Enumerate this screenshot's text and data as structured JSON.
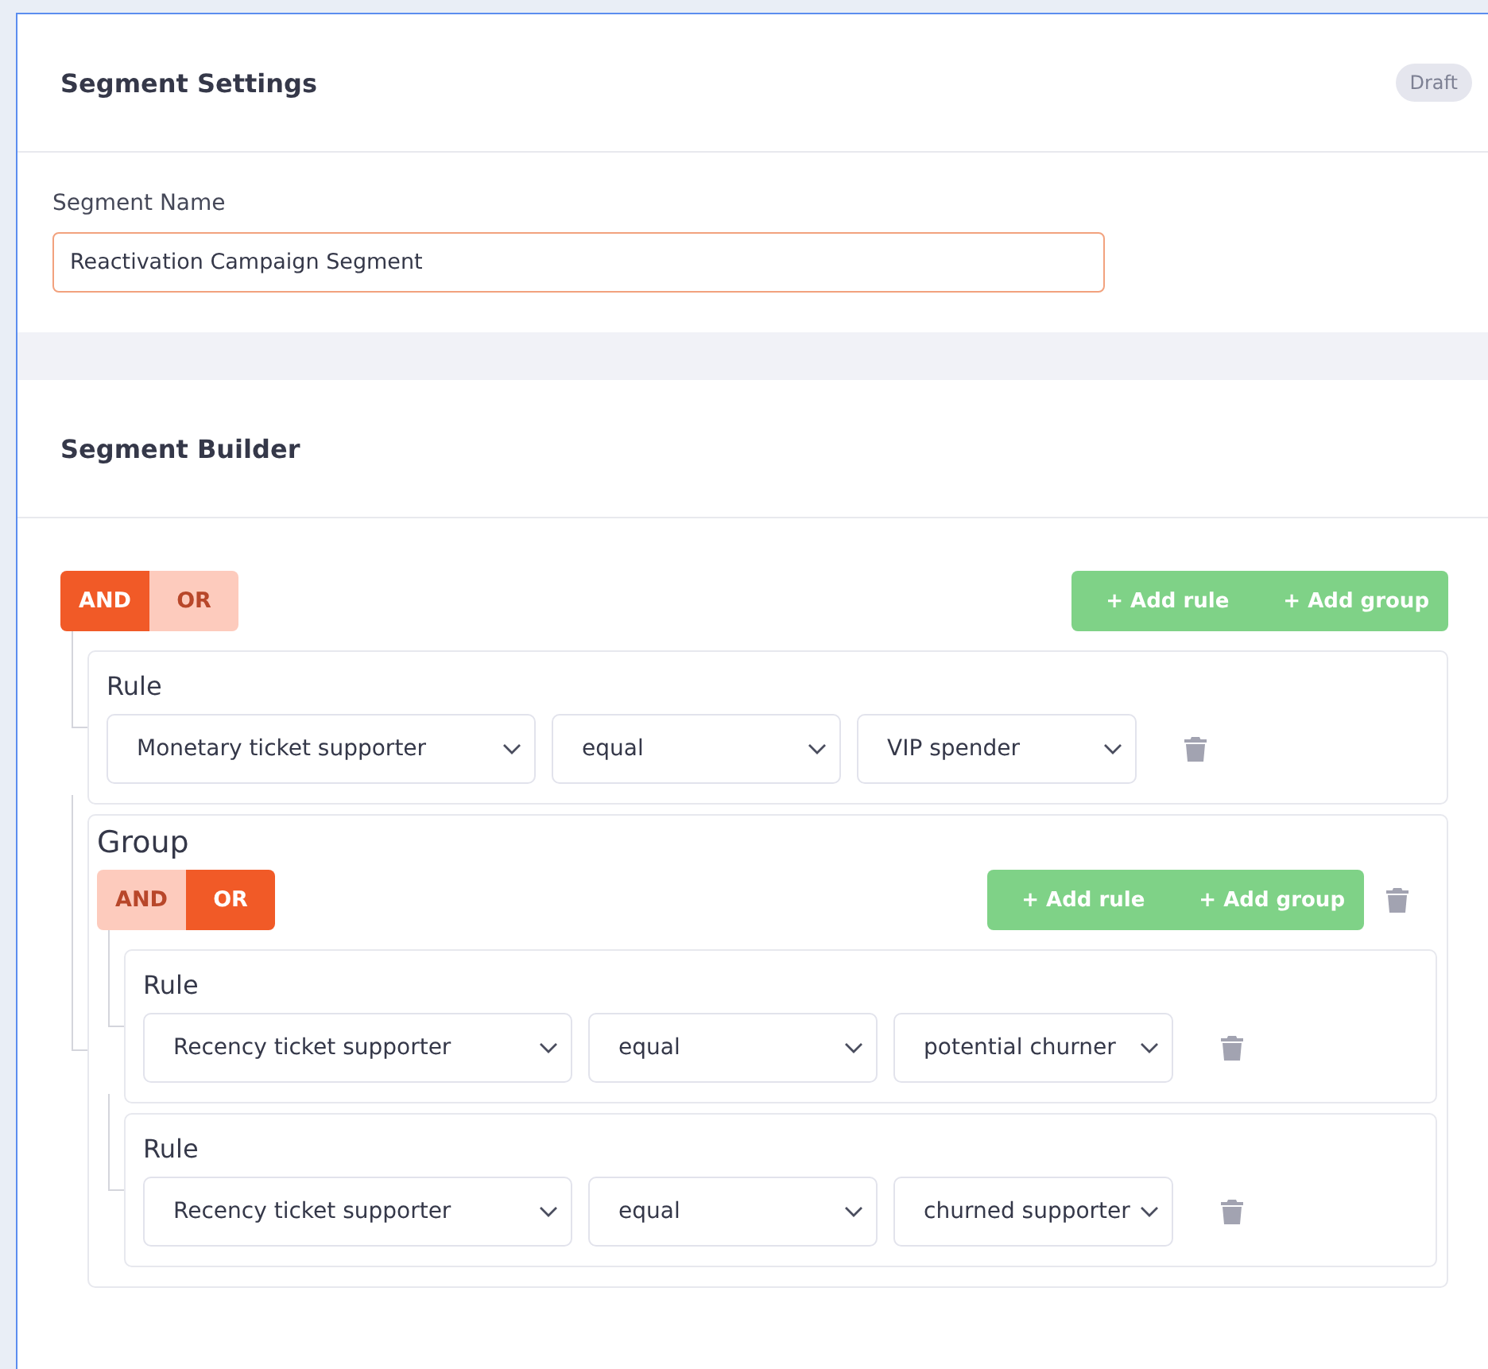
{
  "settings": {
    "title": "Segment Settings",
    "badge": "Draft",
    "name_field": {
      "label": "Segment Name",
      "value": "Reactivation Campaign Segment"
    }
  },
  "builder": {
    "title": "Segment Builder",
    "group": {
      "combinators": [
        {
          "label": "AND",
          "selected": true
        },
        {
          "label": "OR",
          "selected": false
        }
      ],
      "actions": [
        "+ Add rule",
        "+ Add group"
      ],
      "children": [
        {
          "kind": "rule",
          "title": "Rule",
          "fields": [
            "Monetary ticket supporter",
            "equal",
            "VIP spender"
          ]
        },
        {
          "kind": "group",
          "title": "Group",
          "combinators": [
            {
              "label": "AND",
              "selected": false
            },
            {
              "label": "OR",
              "selected": true
            }
          ],
          "actions": [
            "+ Add rule",
            "+ Add group"
          ],
          "children": [
            {
              "kind": "rule",
              "title": "Rule",
              "fields": [
                "Recency ticket supporter",
                "equal",
                "potential churner"
              ]
            },
            {
              "kind": "rule",
              "title": "Rule",
              "fields": [
                "Recency ticket supporter",
                "equal",
                "churned supporter"
              ]
            }
          ]
        }
      ]
    }
  }
}
